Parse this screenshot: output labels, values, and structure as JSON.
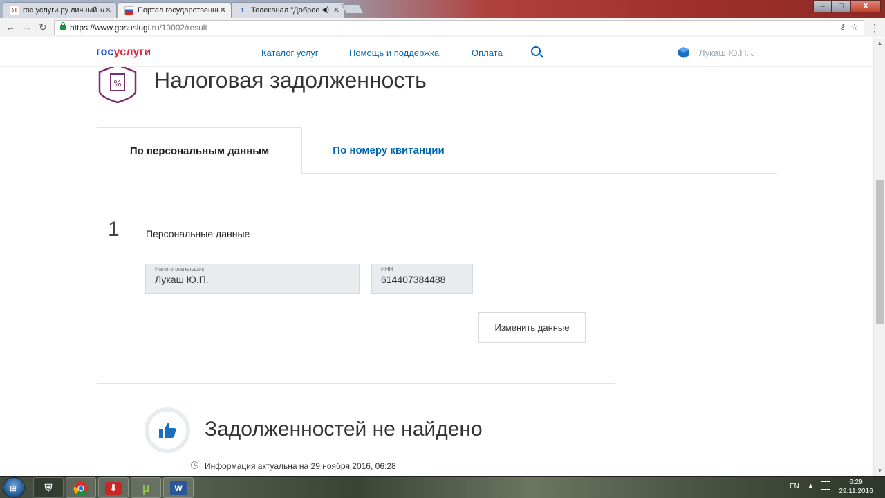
{
  "browser": {
    "tabs": [
      {
        "title": "гос услуги.ру личный ка",
        "favicon": "yandex-icon",
        "active": false
      },
      {
        "title": "Портал государственнь",
        "favicon": "russia-flag-icon",
        "active": true
      },
      {
        "title": "Телеканал \"Доброе у",
        "favicon": "tv-channel-icon",
        "active": false
      }
    ],
    "url_host": "https://www.gosuslugi.ru",
    "url_path": "/10002/result",
    "window_controls": {
      "minimize": "–",
      "maximize": "□",
      "close": "X"
    }
  },
  "site": {
    "logo_part1": "гос",
    "logo_part2": "услуги",
    "nav": [
      "Каталог услуг",
      "Помощь и поддержка",
      "Оплата"
    ],
    "user_name": "Лукаш Ю.П."
  },
  "page": {
    "title": "Налоговая задолженность",
    "tabs": [
      "По персональным данным",
      "По номеру квитанции"
    ],
    "step_number": "1",
    "step_label": "Персональные данные",
    "fields": [
      {
        "label": "Налогоплательщик",
        "value": "Лукаш Ю.П."
      },
      {
        "label": "ИНН",
        "value": "614407384488"
      }
    ],
    "edit_button": "Изменить данные",
    "result_title": "Задолженностей не найдено",
    "info_text": "Информация актуальна на 29 ноября 2016, 06:28"
  },
  "taskbar": {
    "apps": [
      "world-of-tanks-icon",
      "chrome-icon",
      "download-icon",
      "utorrent-icon",
      "word-icon"
    ],
    "language": "EN",
    "time": "6:29",
    "date": "29.11.2016"
  },
  "colors": {
    "brand_blue": "#0d4cd3",
    "brand_red": "#e3263a",
    "link_blue": "#0065b1",
    "service_icon_purple": "#7b2d6e"
  }
}
